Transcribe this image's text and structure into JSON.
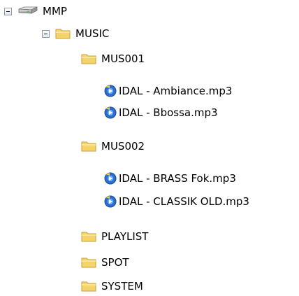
{
  "tree": {
    "root": {
      "label": "MMP",
      "icon": "drive-icon"
    },
    "music": {
      "label": "MUSIC",
      "icon": "folder-icon"
    },
    "mus001": {
      "label": "MUS001",
      "icon": "folder-icon"
    },
    "mus001_files": [
      {
        "label": "IDAL - Ambiance.mp3",
        "icon": "audio-file-icon"
      },
      {
        "label": "IDAL - Bbossa.mp3",
        "icon": "audio-file-icon"
      }
    ],
    "mus002": {
      "label": "MUS002",
      "icon": "folder-icon"
    },
    "mus002_files": [
      {
        "label": "IDAL - BRASS Fok.mp3",
        "icon": "audio-file-icon"
      },
      {
        "label": "IDAL - CLASSIK OLD.mp3",
        "icon": "audio-file-icon"
      }
    ],
    "playlist": {
      "label": "PLAYLIST",
      "icon": "folder-icon"
    },
    "spot": {
      "label": "SPOT",
      "icon": "folder-icon"
    },
    "system": {
      "label": "SYSTEM",
      "icon": "folder-icon"
    }
  },
  "colors": {
    "folder": "#f3d36b",
    "folder_edge": "#c9a23a",
    "expander_border": "#8a9bb0"
  }
}
